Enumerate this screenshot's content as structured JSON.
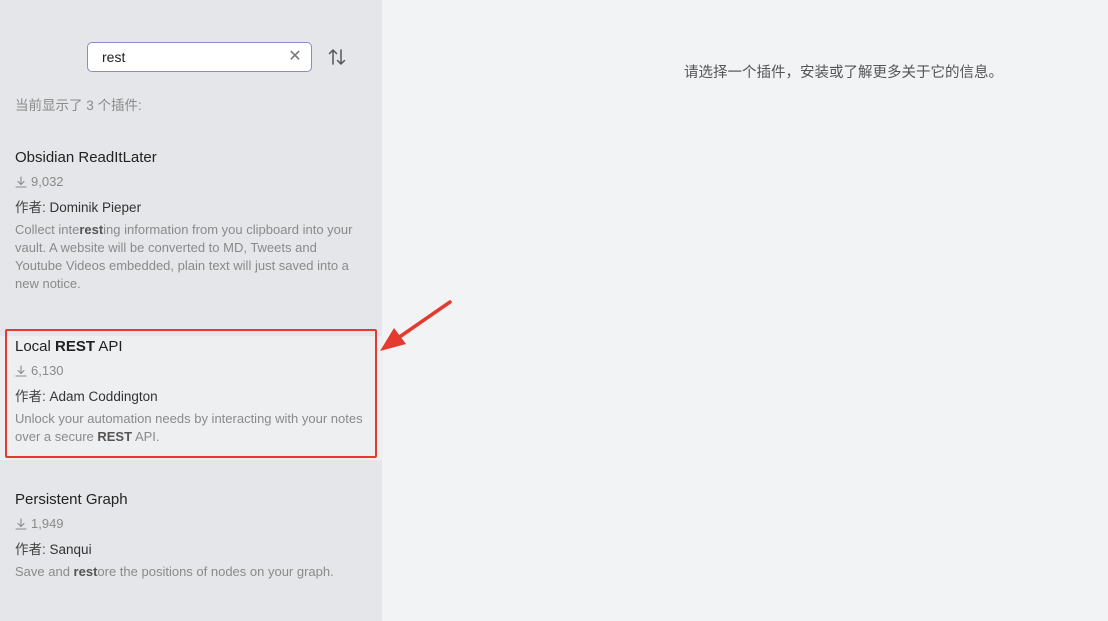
{
  "search": {
    "value": "rest",
    "clear_icon": "close-icon",
    "sort_icon": "sort-arrows-icon"
  },
  "results_count_text": "当前显示了 3 个插件:",
  "plugins": [
    {
      "name_parts": [
        "Obsidian ReadItLater",
        "",
        ""
      ],
      "downloads": "9,032",
      "author_label": "作者:",
      "author": "Dominik Pieper",
      "desc_parts": [
        "Collect inte",
        "rest",
        "ing information from you clipboard into your vault. A website will be converted to MD, Tweets and Youtube Videos embedded, plain text will just saved into a new notice.",
        "",
        ""
      ]
    },
    {
      "name_parts": [
        "Local ",
        "REST",
        " API"
      ],
      "downloads": "6,130",
      "author_label": "作者:",
      "author": "Adam Coddington",
      "desc_parts": [
        "Unlock your automation needs by interacting with your notes over a secure ",
        "REST",
        " API.",
        "",
        ""
      ]
    },
    {
      "name_parts": [
        "Persistent Graph",
        "",
        ""
      ],
      "downloads": "1,949",
      "author_label": "作者:",
      "author": "Sanqui",
      "desc_parts": [
        "Save and ",
        "rest",
        "ore the positions of nodes on your graph.",
        "",
        ""
      ]
    }
  ],
  "main": {
    "message": "请选择一个插件，安装或了解更多关于它的信息。"
  },
  "annotation": {
    "box_color": "#e53a30",
    "arrow_color": "#e53a30"
  },
  "colors": {
    "sidebar_bg": "#e5e6e9",
    "main_bg": "#f2f3f5",
    "search_border": "#8d86d9"
  }
}
